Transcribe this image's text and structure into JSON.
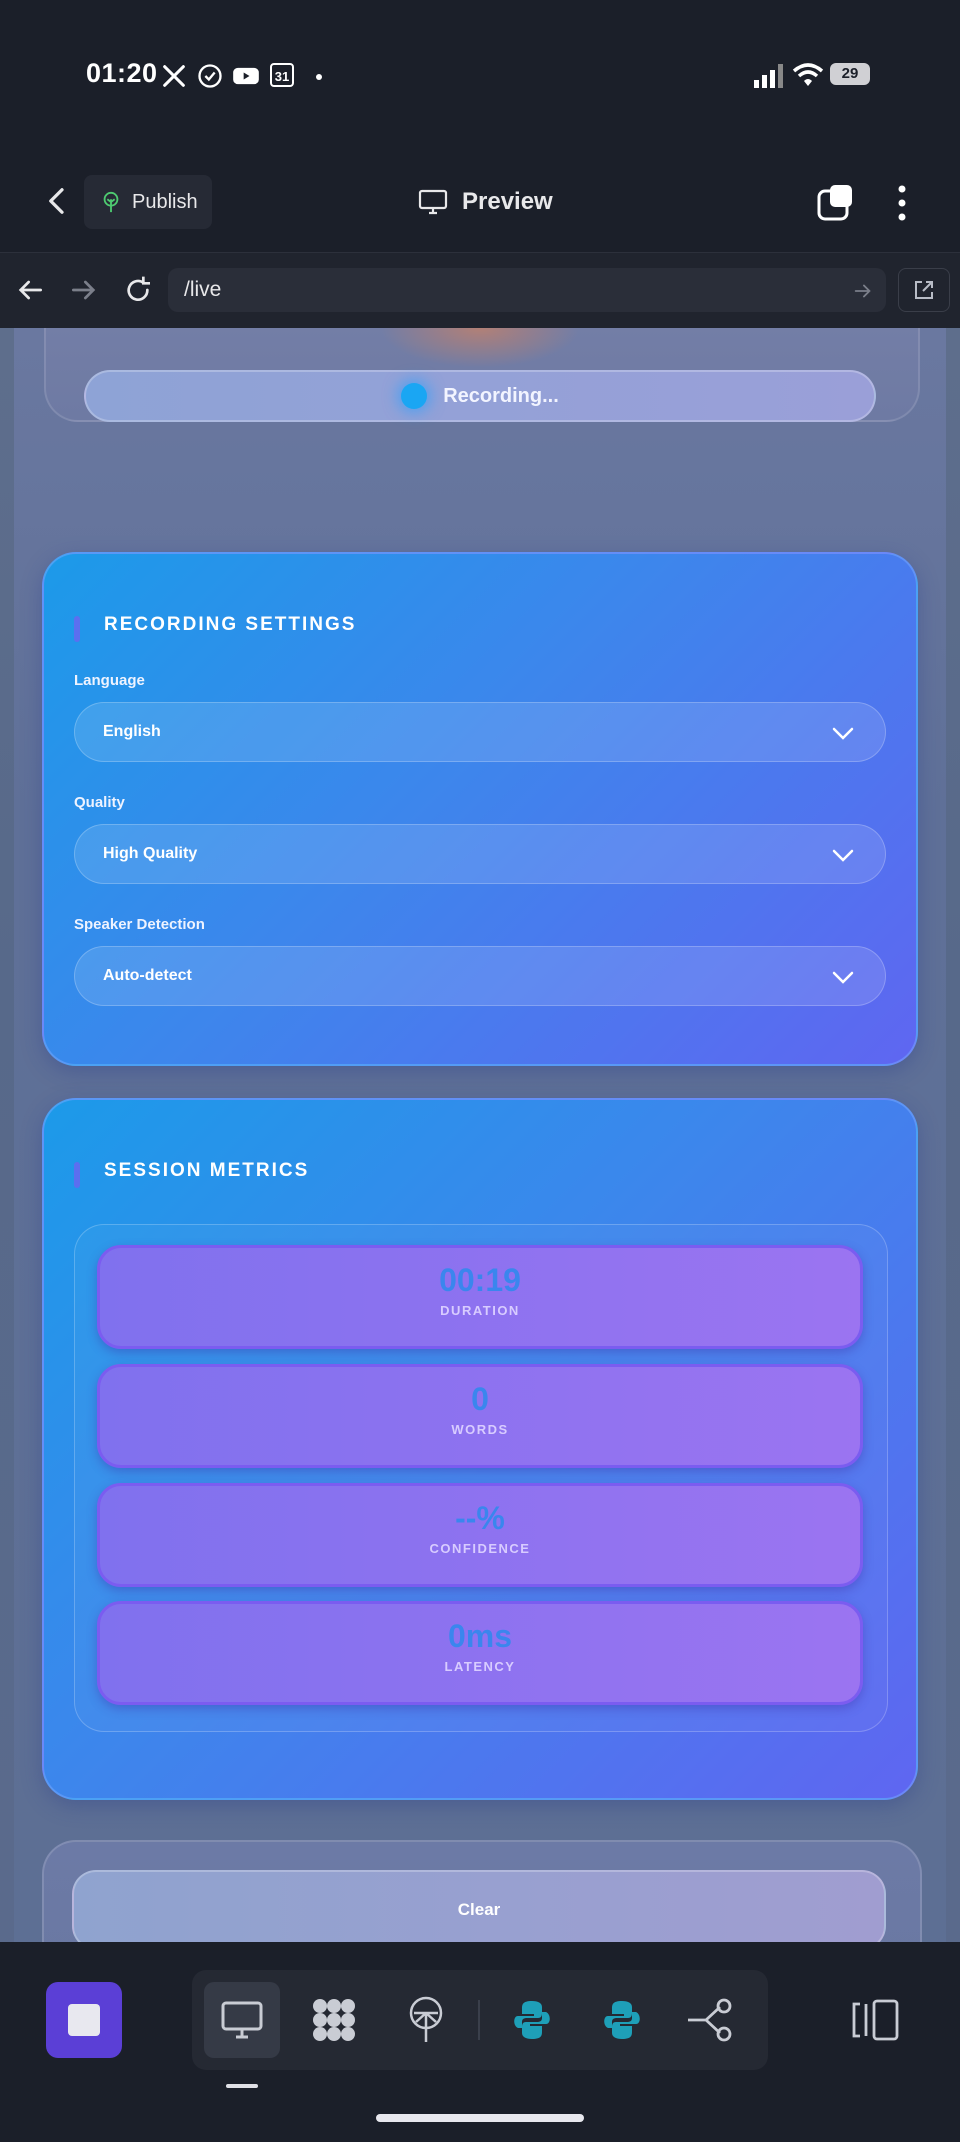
{
  "status_bar": {
    "time": "01:20",
    "battery": "29",
    "icons": [
      "x-icon",
      "check-circle-icon",
      "youtube-icon",
      "calendar-icon",
      "dot-icon",
      "signal-icon",
      "wifi-icon",
      "battery-icon"
    ],
    "calendar_day": "31"
  },
  "header": {
    "publish_label": "Publish",
    "preview_label": "Preview"
  },
  "browser": {
    "url": "/live"
  },
  "recorder": {
    "status_text": "Recording..."
  },
  "settings": {
    "title": "RECORDING SETTINGS",
    "fields": [
      {
        "label": "Language",
        "value": "English"
      },
      {
        "label": "Quality",
        "value": "High Quality"
      },
      {
        "label": "Speaker Detection",
        "value": "Auto-detect"
      }
    ]
  },
  "metrics": {
    "title": "SESSION METRICS",
    "items": [
      {
        "value": "00:19",
        "label": "DURATION"
      },
      {
        "value": "0",
        "label": "WORDS"
      },
      {
        "value": "--%",
        "label": "CONFIDENCE"
      },
      {
        "value": "0ms",
        "label": "LATENCY"
      }
    ]
  },
  "actions": {
    "clear_label": "Clear"
  },
  "colors": {
    "accent_blue": "#1c9ae9",
    "accent_purple": "#5f66f1",
    "metric_value": "#3a86ee",
    "stop_button": "#5b3fd6"
  },
  "toolbar": {
    "items": [
      "stop-button",
      "desktop-preview-icon",
      "dots-grid-icon",
      "publish-tree-icon",
      "python-icon",
      "python-icon",
      "share-nodes-icon",
      "sidebar-toggle-icon"
    ]
  }
}
